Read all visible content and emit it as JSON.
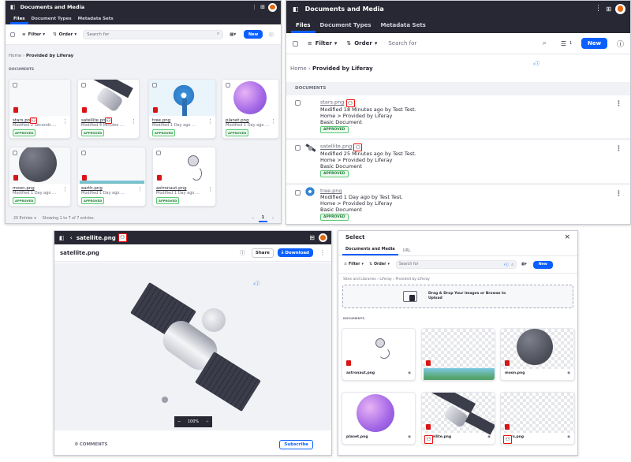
{
  "colors": {
    "dark": "#272833",
    "primary": "#0b5fff",
    "approved_border": "#5aca75",
    "approved_text": "#287d3c",
    "highlight": "#ee1111",
    "pdf_red": "#da1414"
  },
  "panelA": {
    "title": "Documents and Media",
    "tabs": [
      "Files",
      "Document Types",
      "Metadata Sets"
    ],
    "filter_label": "Filter",
    "order_label": "Order",
    "search_placeholder": "Search for",
    "new_label": "New",
    "breadcrumb_home": "Home",
    "breadcrumb_current": "Provided by Liferay",
    "section": "DOCUMENTS",
    "badge": "APPROVED",
    "cards": [
      {
        "name": "stars.png",
        "meta": "Modified 2 Seconds ago by T..."
      },
      {
        "name": "satellite.png",
        "meta": "Modified 4 Minutes ago by ..."
      },
      {
        "name": "tree.png",
        "meta": "Modified 1 Day ago by T..."
      },
      {
        "name": "planet.png",
        "meta": "Modified 1 Day ago by T..."
      },
      {
        "name": "moon.png",
        "meta": "Modified 1 Day ago by T..."
      },
      {
        "name": "earth.png",
        "meta": "Modified 1 Day ago by T..."
      },
      {
        "name": "astronaut.png",
        "meta": "Modified 1 Day ago by T..."
      }
    ],
    "footer_entries": "20 Entries",
    "footer_showing": "Showing 1 to 7 of 7 entries.",
    "page": "1"
  },
  "panelB": {
    "title": "Documents and Media",
    "tabs": [
      "Files",
      "Document Types",
      "Metadata Sets"
    ],
    "filter_label": "Filter",
    "order_label": "Order",
    "search_placeholder": "Search for",
    "new_label": "New",
    "count": "1",
    "breadcrumb_home": "Home",
    "breadcrumb_current": "Provided by Liferay",
    "section": "DOCUMENTS",
    "items": [
      {
        "name": "stars.png",
        "modified": "Modified 18 Minutes ago by Test Test.",
        "path": "Home > Provided by Liferay",
        "type": "Basic Document",
        "status": "APPROVED"
      },
      {
        "name": "satellite.png",
        "modified": "Modified 25 Minutes ago by Test Test.",
        "path": "Home > Provided by Liferay",
        "type": "Basic Document",
        "status": "APPROVED"
      },
      {
        "name": "tree.png",
        "modified": "Modified 1 Day ago by Test Test.",
        "path": "Home > Provided by Liferay",
        "type": "Basic Document",
        "status": "APPROVED"
      }
    ]
  },
  "panelC": {
    "title": "satellite.png",
    "file_title": "satellite.png",
    "share_label": "Share",
    "download_label": "Download",
    "zoom": "100%",
    "comments": "0 COMMENTS",
    "subscribe_label": "Subscribe"
  },
  "panelD": {
    "title": "Select",
    "tabs": [
      "Documents and Media",
      "URL"
    ],
    "filter_label": "Filter",
    "order_label": "Order",
    "search_placeholder": "Search for",
    "new_label": "New",
    "breadcrumb": [
      "Sites and Libraries",
      "Liferay",
      "Provided by Liferay"
    ],
    "drop_text": "Drag & Drop Your Images or Browse to Upload",
    "section": "DOCUMENTS",
    "cards": [
      {
        "name": "astronaut.png"
      },
      {
        "name": "earth.png"
      },
      {
        "name": "moon.png"
      },
      {
        "name": "planet.png"
      },
      {
        "name": "satellite.png"
      },
      {
        "name": "stars.png"
      }
    ]
  }
}
